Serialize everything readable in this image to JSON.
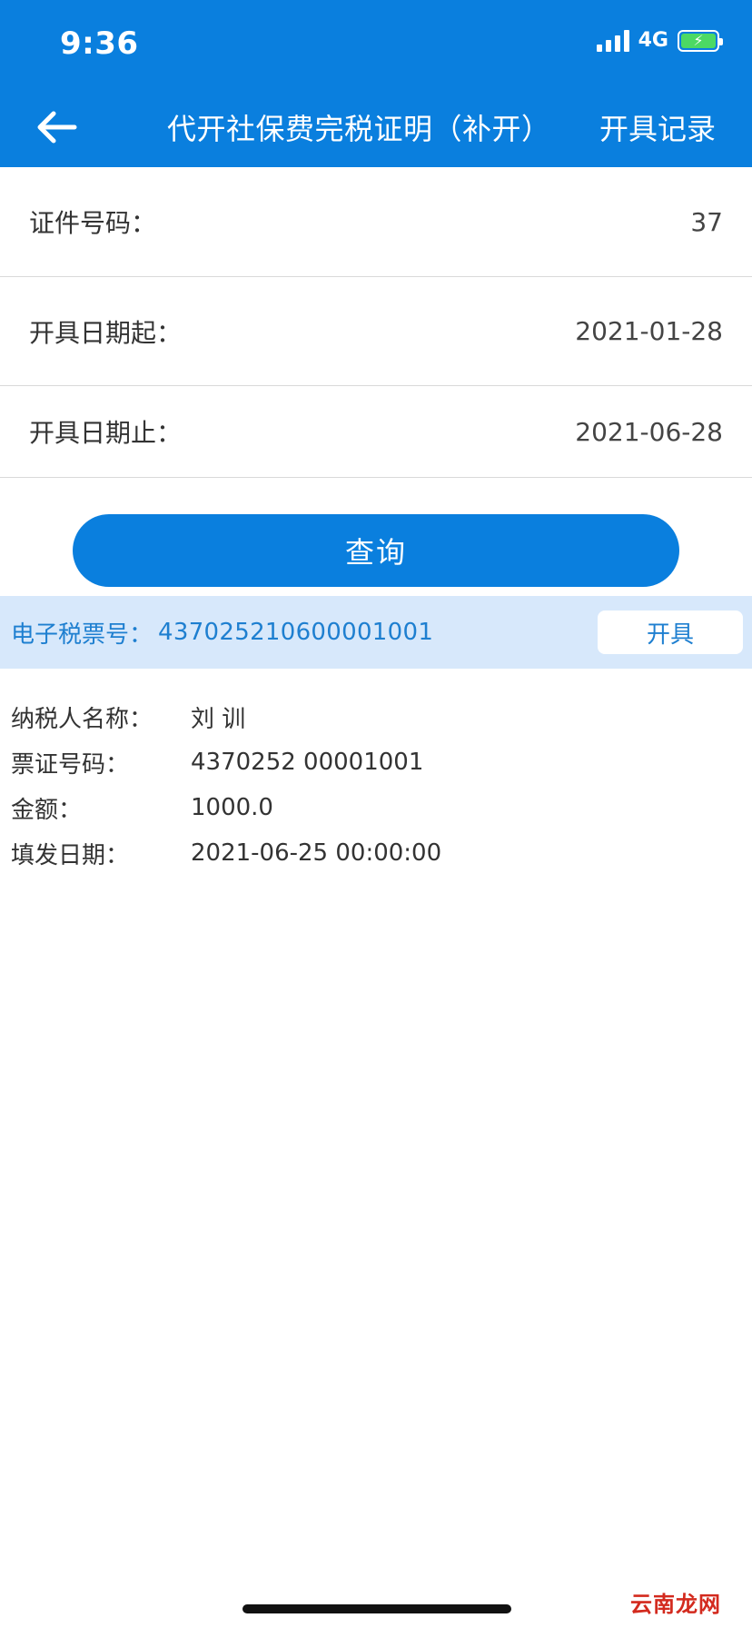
{
  "status_bar": {
    "time": "9:36",
    "network": "4G",
    "battery_charging_glyph": "⚡"
  },
  "nav": {
    "back_icon": "arrow-left-icon",
    "title": "代开社保费完税证明（补开）",
    "action_label": "开具记录"
  },
  "form": {
    "rows": [
      {
        "label": "证件号码：",
        "value": "37"
      },
      {
        "label": "开具日期起：",
        "value": "2021-01-28"
      },
      {
        "label": "开具日期止：",
        "value": "2021-06-28"
      }
    ]
  },
  "query_button": {
    "label": "查询"
  },
  "result": {
    "ticket_label": "电子税票号：",
    "ticket_no": "437025210600001001",
    "issue_button_label": "开具",
    "details": [
      {
        "label": "纳税人名称：",
        "value": "刘 训"
      },
      {
        "label": "票证号码：",
        "value": "4370252  00001001"
      },
      {
        "label": "金额：",
        "value": "1000.0"
      },
      {
        "label": "填发日期：",
        "value": "2021-06-25 00:00:00"
      }
    ]
  },
  "watermark": {
    "text": "云南龙网"
  },
  "colors": {
    "primary": "#0a7fde",
    "result_bar_bg": "#d7e8fb",
    "link_blue": "#1e7fd0",
    "battery_green": "#4cd964",
    "watermark_red": "#d32a1e"
  }
}
